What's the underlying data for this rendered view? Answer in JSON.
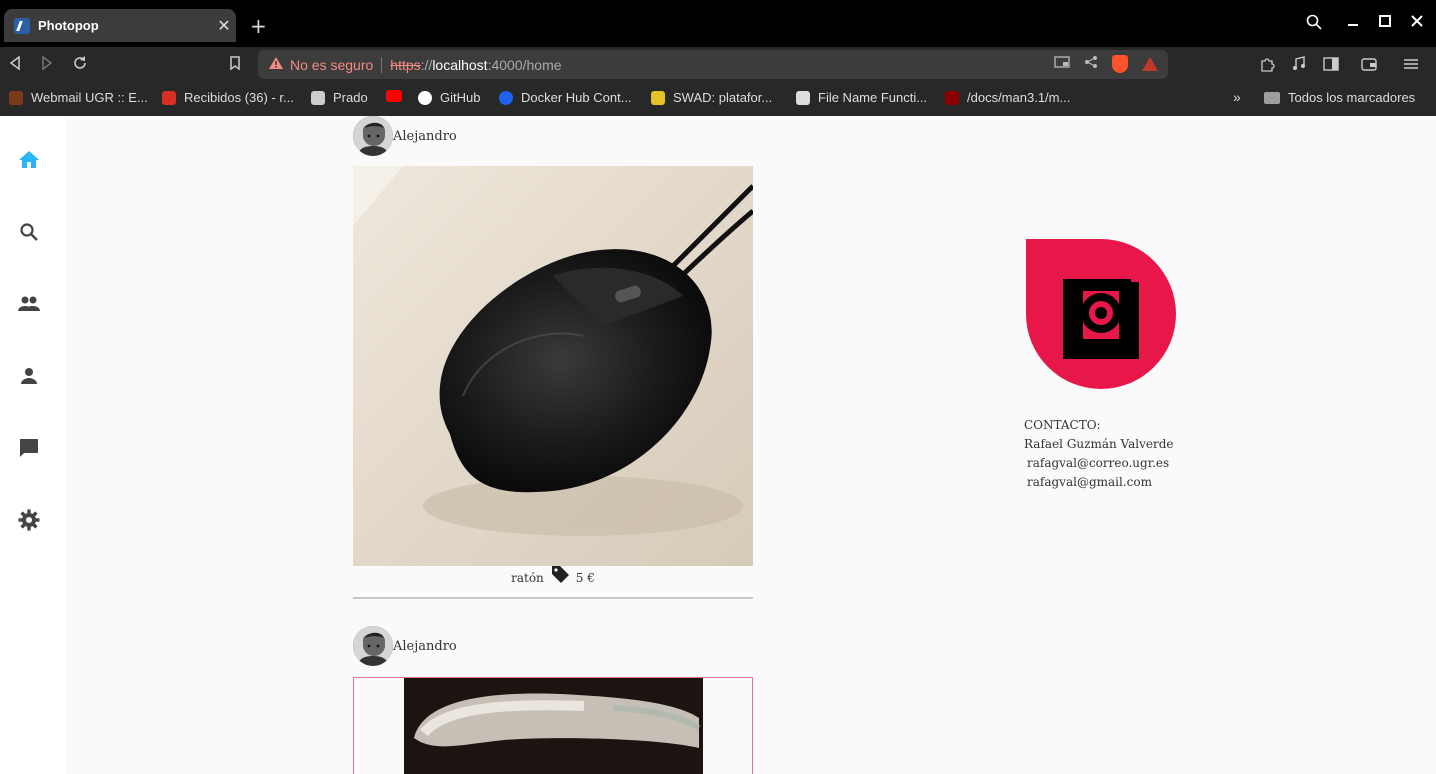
{
  "browser": {
    "tab_title": "Photopop",
    "new_tab": "+",
    "close_tab": "✕",
    "not_secure": "No es seguro",
    "url_scheme": "https",
    "url_sep": "://",
    "url_host": "localhost",
    "url_path": ":4000/home",
    "bookmarks": [
      {
        "label": "Webmail UGR :: E...",
        "color": "#7a3b1d"
      },
      {
        "label": "Recibidos (36) - r...",
        "color": "#d93025"
      },
      {
        "label": "Prado",
        "color": "#cccccc"
      },
      {
        "label": "",
        "color": "#ff0000"
      },
      {
        "label": "GitHub",
        "color": "#ffffff"
      },
      {
        "label": "Docker Hub Cont...",
        "color": "#1d63ed"
      },
      {
        "label": "SWAD: platafor...",
        "color": "#e6c229"
      },
      {
        "label": "File Name Functi...",
        "color": "#dddddd"
      },
      {
        "label": "/docs/man3.1/m...",
        "color": "#8b0000"
      }
    ],
    "bookmarks_more": "»",
    "all_bookmarks": "Todos los marcadores"
  },
  "nav": {
    "items": [
      "home-icon",
      "search-icon",
      "people-icon",
      "person-icon",
      "chat-icon",
      "settings-icon"
    ],
    "active_color": "#29b6f6",
    "icon_color": "#444444"
  },
  "posts": [
    {
      "author": "Alejandro",
      "item": "ratón",
      "price": "5 €"
    },
    {
      "author": "Alejandro"
    }
  ],
  "contact": {
    "heading": "CONTACTO:",
    "name": "Rafael Guzmán Valverde",
    "email1": "rafagval@correo.ugr.es",
    "email2": "rafagval@gmail.com"
  },
  "brand": {
    "logo_color": "#e8174a"
  }
}
